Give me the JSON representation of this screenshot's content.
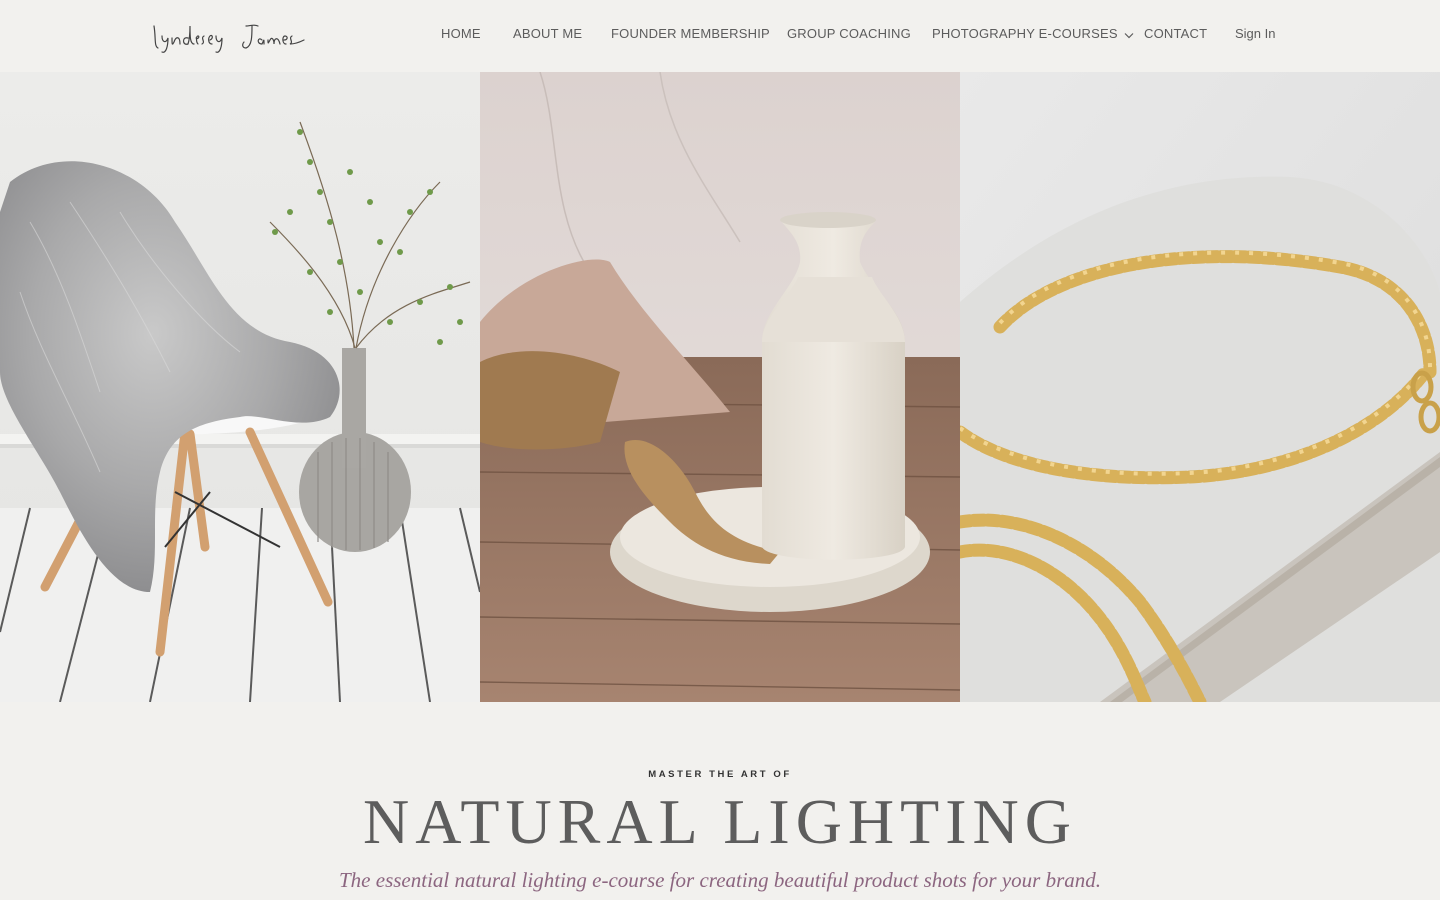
{
  "header": {
    "logo_text": "lyndsey James",
    "nav": [
      {
        "label": "HOME"
      },
      {
        "label": "ABOUT ME"
      },
      {
        "label": "FOUNDER MEMBERSHIP"
      },
      {
        "label": "GROUP COACHING"
      },
      {
        "label": "PHOTOGRAPHY E-COURSES",
        "icon": "chevron-down-icon"
      },
      {
        "label": "CONTACT"
      },
      {
        "label": "Sign In"
      }
    ]
  },
  "hero": {
    "panels": [
      {
        "name": "chair-sheepskin-photo"
      },
      {
        "name": "ceramic-jug-photo"
      },
      {
        "name": "gold-bracelet-photo"
      }
    ]
  },
  "intro": {
    "eyebrow": "MASTER THE ART OF",
    "headline": "NATURAL LIGHTING",
    "subline": "The essential natural lighting e-course for creating beautiful product shots for your brand."
  },
  "colors": {
    "background": "#f2f1ee",
    "nav_text": "#5c5c5c",
    "headline": "#5d5d5d",
    "subline_accent": "#8c6680"
  }
}
